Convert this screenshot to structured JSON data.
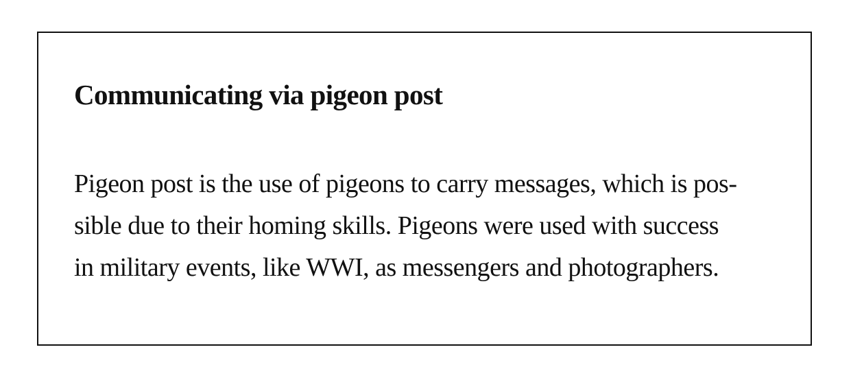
{
  "article": {
    "title": "Communicating via pigeon post",
    "body_lines": [
      "Pigeon post is the use of pigeons to carry messages, which is pos-",
      "sible due to their homing skills. Pigeons were used with success",
      "in military events, like WWI, as messengers and photographers."
    ]
  },
  "colors": {
    "text": "#111111",
    "border": "#111111",
    "background": "#ffffff"
  }
}
